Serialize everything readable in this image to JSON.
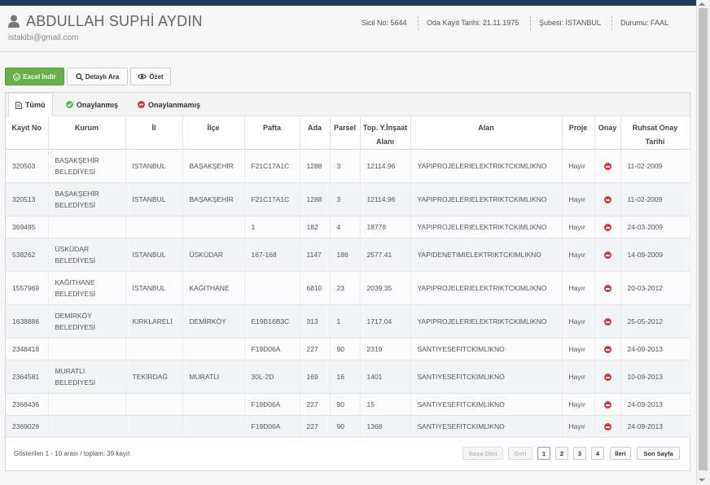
{
  "header": {
    "name": "ABDULLAH SUPHİ AYDIN",
    "email": "istakibi@gmail.com",
    "sicil": "Sicil No: 5644",
    "oda": "Oda Kayıt Tarihi: 21.11.1975",
    "sube": "Şubesi: İSTANBUL",
    "durum": "Durumu: FAAL"
  },
  "toolbar": {
    "excel": "Excel İndir",
    "detay": "Detaylı Ara",
    "ozet": "Özet"
  },
  "tabs": {
    "tumu": "Tümü",
    "onay": "Onaylanmış",
    "onaysiz": "Onaylanmamış"
  },
  "columns": {
    "kayit": "Kayıt No",
    "kurum": "Kurum",
    "il": "İl",
    "ilce": "İlçe",
    "pafta": "Pafta",
    "ada": "Ada",
    "parsel": "Parsel",
    "top1": "Top. Y.İnşaat",
    "top2": "Alanı",
    "alan": "Alan",
    "proje": "Proje",
    "onay": "Onay",
    "ruhsat1": "Ruhsat Onay",
    "ruhsat2": "Tarihi"
  },
  "rows": [
    {
      "kayit": "320503",
      "kurum1": "BAŞAKŞEHİR",
      "kurum2": "BELEDİYESİ",
      "il": "İSTANBUL",
      "ilce": "BAŞAKŞEHİR",
      "pafta": "F21C17A1C",
      "ada": "1288",
      "parsel": "3",
      "alan_m2": "12114.96",
      "alan": "YAPIPROJELERIELEKTRIKTCKIMLIKNO",
      "proje": "Hayır",
      "tarih": "11-02-2009"
    },
    {
      "kayit": "320513",
      "kurum1": "BAŞAKŞEHİR",
      "kurum2": "BELEDİYESİ",
      "il": "İSTANBUL",
      "ilce": "BAŞAKŞEHİR",
      "pafta": "F21C17A1C",
      "ada": "1288",
      "parsel": "3",
      "alan_m2": "12114.96",
      "alan": "YAPIPROJELERIELEKTRIKTCKIMLIKNO",
      "proje": "Hayır",
      "tarih": "11-02-2009"
    },
    {
      "kayit": "369495",
      "kurum1": "",
      "kurum2": "",
      "il": "",
      "ilce": "",
      "pafta": "1",
      "ada": "182",
      "parsel": "4",
      "alan_m2": "18778",
      "alan": "YAPIPROJELERIELEKTRIKTCKIMLIKNO",
      "proje": "Hayır",
      "tarih": "24-03-2009"
    },
    {
      "kayit": "538262",
      "kurum1": "ÜSKÜDAR",
      "kurum2": "BELEDİYESİ",
      "il": "İSTANBUL",
      "ilce": "ÜSKÜDAR",
      "pafta": "167-168",
      "ada": "1147",
      "parsel": "188",
      "alan_m2": "2577.41",
      "alan": "YAPIDENETIMIELEKTRIKTCKIMLIKNO",
      "proje": "Hayır",
      "tarih": "14-09-2009"
    },
    {
      "kayit": "1557969",
      "kurum1": "KAĞITHANE",
      "kurum2": "BELEDİYESİ",
      "il": "İSTANBUL",
      "ilce": "KAĞITHANE",
      "pafta": "",
      "ada": "6810",
      "parsel": "23",
      "alan_m2": "2039.35",
      "alan": "YAPIPROJELERIELEKTRIKTCKIMLIKNO",
      "proje": "Hayır",
      "tarih": "20-03-2012"
    },
    {
      "kayit": "1638886",
      "kurum1": "DEMİRKÖY",
      "kurum2": "BELEDİYESİ",
      "il": "KIRKLARELİ",
      "ilce": "DEMİRKÖY",
      "pafta": "E19B16B3C",
      "ada": "313",
      "parsel": "1",
      "alan_m2": "1717.04",
      "alan": "YAPIPROJELERIELEKTRIKTCKIMLIKNO",
      "proje": "Hayır",
      "tarih": "25-05-2012"
    },
    {
      "kayit": "2348418",
      "kurum1": "",
      "kurum2": "",
      "il": "",
      "ilce": "",
      "pafta": "F19D06A",
      "ada": "227",
      "parsel": "90",
      "alan_m2": "2319",
      "alan": "SANTIYESEFITCKIMLIKNO",
      "proje": "Hayır",
      "tarih": "24-09-2013"
    },
    {
      "kayit": "2364581",
      "kurum1": "MURATLI",
      "kurum2": "BELEDİYESİ",
      "il": "TEKİRDAĞ",
      "ilce": "MURATLI",
      "pafta": "30L-2D",
      "ada": "169",
      "parsel": "16",
      "alan_m2": "1401",
      "alan": "SANTIYESEFITCKIMLIKNO",
      "proje": "Hayır",
      "tarih": "10-09-2013"
    },
    {
      "kayit": "2368436",
      "kurum1": "",
      "kurum2": "",
      "il": "",
      "ilce": "",
      "pafta": "F19D06A",
      "ada": "227",
      "parsel": "90",
      "alan_m2": "15",
      "alan": "SANTIYESEFITCKIMLIKNO",
      "proje": "Hayır",
      "tarih": "24-09-2013"
    },
    {
      "kayit": "2369028",
      "kurum1": "",
      "kurum2": "",
      "il": "",
      "ilce": "",
      "pafta": "F19D06A",
      "ada": "227",
      "parsel": "90",
      "alan_m2": "1368",
      "alan": "SANTIYESEFITCKIMLIKNO",
      "proje": "Hayır",
      "tarih": "24-09-2013"
    }
  ],
  "footer": {
    "info": "Gösterilen 1 - 10 arası / toplam: 39 kayıt",
    "first": "Başa Dön",
    "prev": "Geri",
    "p1": "1",
    "p2": "2",
    "p3": "3",
    "p4": "4",
    "next": "İleri",
    "last": "Son Sayfa"
  },
  "colors": {
    "topbar": "#203a5c",
    "excel": "#68b04a",
    "reject": "#d9363e",
    "approved": "#5cb85c"
  }
}
